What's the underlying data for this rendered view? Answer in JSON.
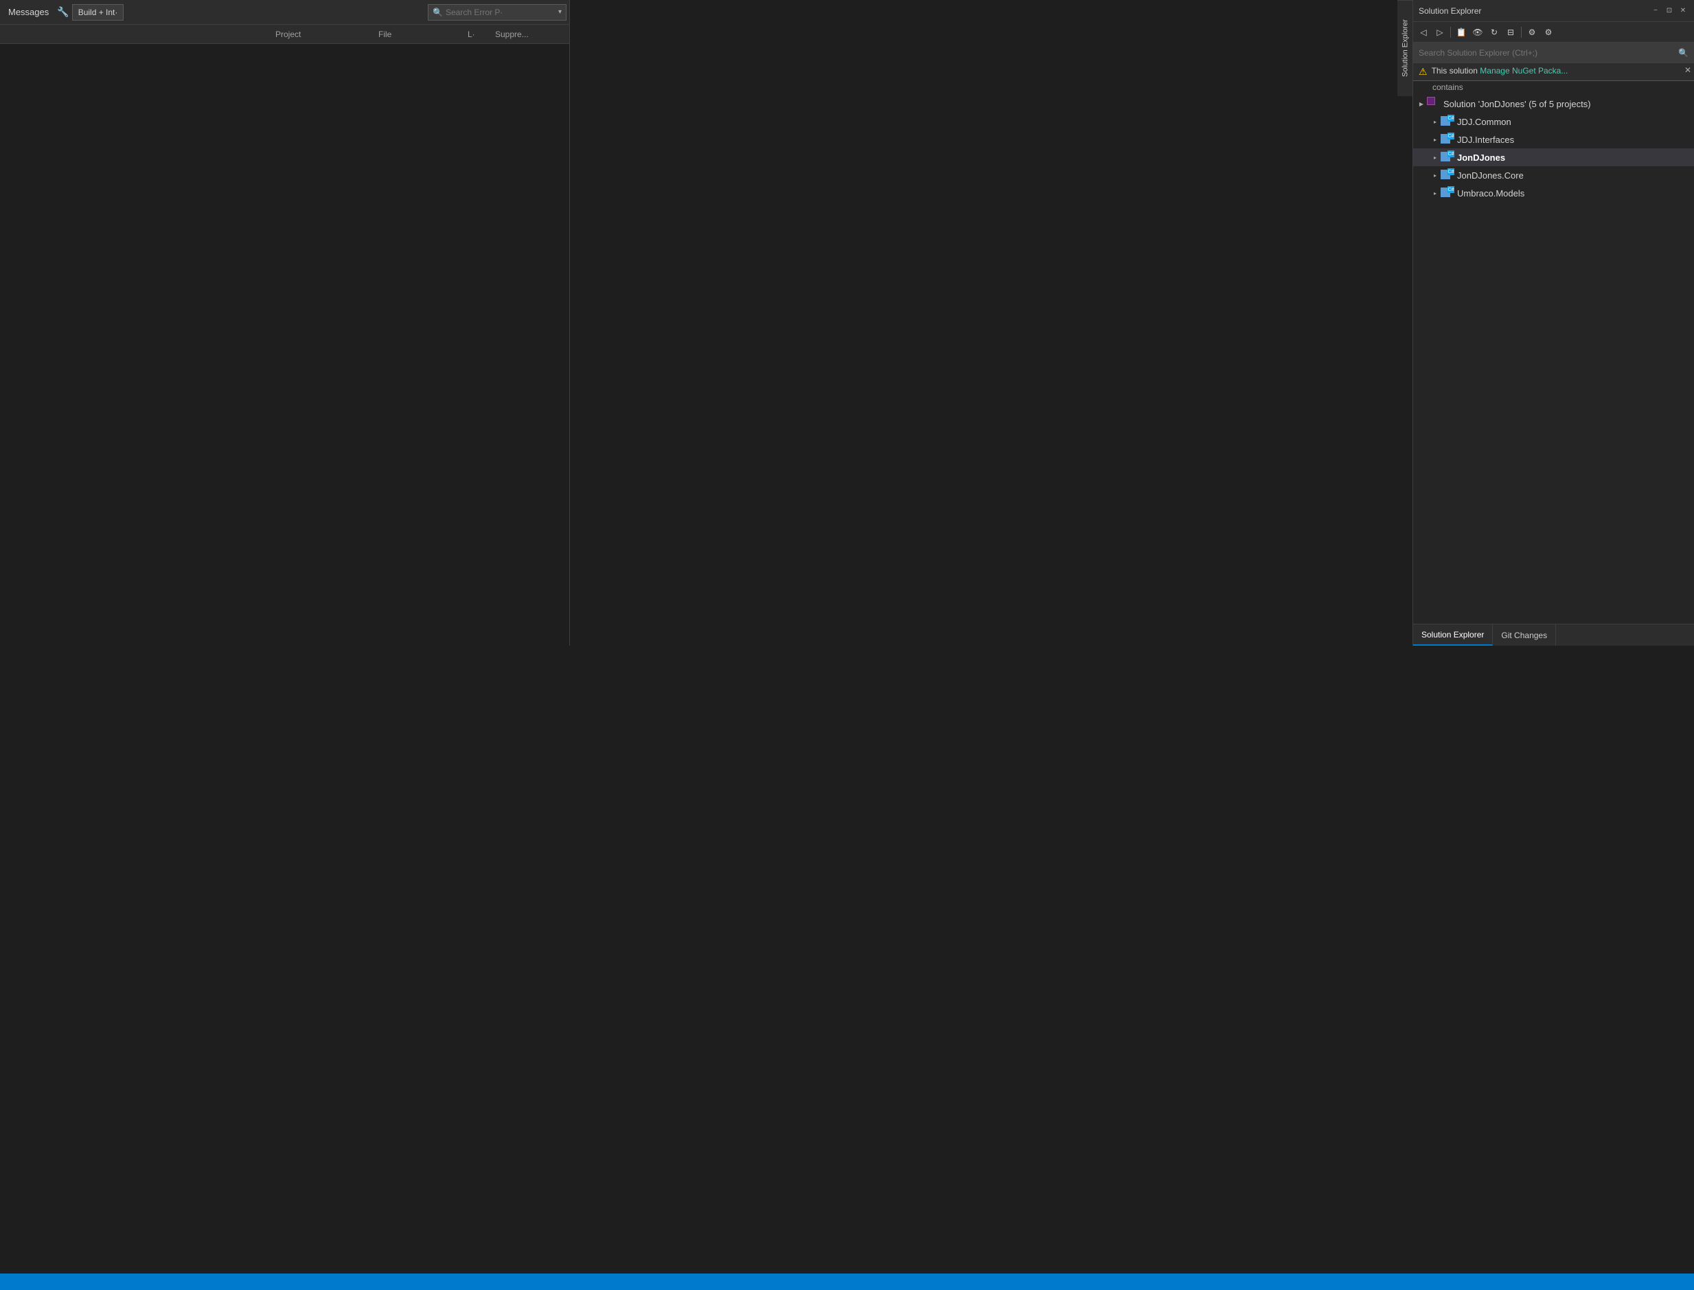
{
  "errorList": {
    "tabLabel": "Messages",
    "buildButton": "Build + Int·",
    "searchPlaceholder": "Search Error P·",
    "columns": {
      "description": "",
      "project": "Project",
      "file": "File",
      "line": "L·",
      "suppress": "Suppre..."
    }
  },
  "solutionExplorer": {
    "title": "Solution Explorer",
    "searchPlaceholder": "Search Solution Explorer (Ctrl+;)",
    "warning": {
      "text": "This solution",
      "link": "Manage NuGet Packa...",
      "contains": "contains"
    },
    "solution": {
      "label": "Solution 'JonDJones' (5 of 5 projects)"
    },
    "projects": [
      {
        "name": "JDJ.Common",
        "indent": 1
      },
      {
        "name": "JDJ.Interfaces",
        "indent": 1
      },
      {
        "name": "JonDJones",
        "indent": 1,
        "selected": true
      },
      {
        "name": "JonDJones.Core",
        "indent": 1
      },
      {
        "name": "Umbraco.Models",
        "indent": 1
      }
    ],
    "bottomTabs": [
      {
        "label": "Solution Explorer",
        "active": true
      },
      {
        "label": "Git Changes",
        "active": false
      }
    ],
    "verticalTab": "Solution Explorer"
  },
  "icons": {
    "collapse": "−",
    "expand": "▸",
    "close": "✕",
    "pin": "⊡",
    "dropdown": "▾",
    "search": "🔍",
    "warning": "⚠",
    "chevronRight": "▶",
    "chevronDown": "▼"
  }
}
